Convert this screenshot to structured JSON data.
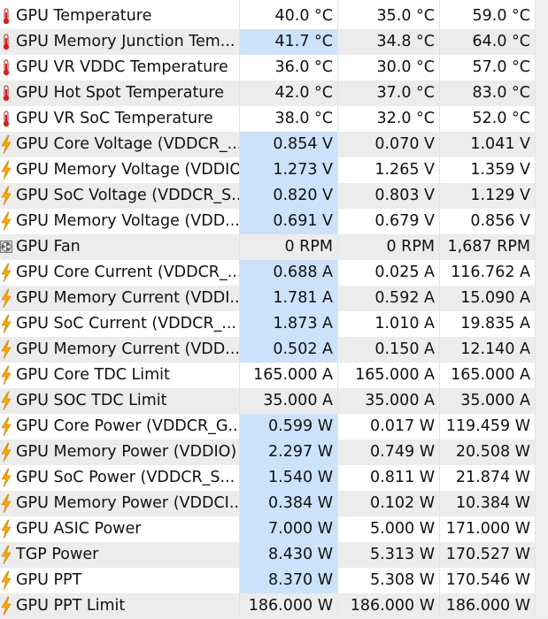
{
  "colors": {
    "alt_row": "#ececec",
    "current_highlight": "#cce2fb",
    "thermometer_red": "#d42020",
    "bolt_orange": "#f5a800",
    "fan_gray": "#666666"
  },
  "rows": [
    {
      "icon": "thermometer-icon",
      "name": "GPU Temperature",
      "current": "40.0 °C",
      "min": "35.0 °C",
      "max": "59.0 °C",
      "hl": false
    },
    {
      "icon": "thermometer-icon",
      "name": "GPU Memory Junction Tem...",
      "current": "41.7 °C",
      "min": "34.8 °C",
      "max": "64.0 °C",
      "hl": true
    },
    {
      "icon": "thermometer-icon",
      "name": "GPU VR VDDC Temperature",
      "current": "36.0 °C",
      "min": "30.0 °C",
      "max": "57.0 °C",
      "hl": false
    },
    {
      "icon": "thermometer-icon",
      "name": "GPU Hot Spot Temperature",
      "current": "42.0 °C",
      "min": "37.0 °C",
      "max": "83.0 °C",
      "hl": false
    },
    {
      "icon": "thermometer-icon",
      "name": "GPU VR SoC Temperature",
      "current": "38.0 °C",
      "min": "32.0 °C",
      "max": "52.0 °C",
      "hl": false
    },
    {
      "icon": "lightning-bolt-icon",
      "name": "GPU Core Voltage (VDDCR_...",
      "current": "0.854 V",
      "min": "0.070 V",
      "max": "1.041 V",
      "hl": true
    },
    {
      "icon": "lightning-bolt-icon",
      "name": "GPU Memory Voltage (VDDIO)",
      "current": "1.273 V",
      "min": "1.265 V",
      "max": "1.359 V",
      "hl": true
    },
    {
      "icon": "lightning-bolt-icon",
      "name": "GPU SoC Voltage (VDDCR_S...",
      "current": "0.820 V",
      "min": "0.803 V",
      "max": "1.129 V",
      "hl": true
    },
    {
      "icon": "lightning-bolt-icon",
      "name": "GPU Memory Voltage (VDD...",
      "current": "0.691 V",
      "min": "0.679 V",
      "max": "0.856 V",
      "hl": true
    },
    {
      "icon": "fan-icon",
      "name": "GPU Fan",
      "current": "0 RPM",
      "min": "0 RPM",
      "max": "1,687 RPM",
      "hl": false
    },
    {
      "icon": "lightning-bolt-icon",
      "name": "GPU Core Current (VDDCR_...",
      "current": "0.688 A",
      "min": "0.025 A",
      "max": "116.762 A",
      "hl": true
    },
    {
      "icon": "lightning-bolt-icon",
      "name": "GPU Memory Current (VDDI...",
      "current": "1.781 A",
      "min": "0.592 A",
      "max": "15.090 A",
      "hl": true
    },
    {
      "icon": "lightning-bolt-icon",
      "name": "GPU SoC Current (VDDCR_...",
      "current": "1.873 A",
      "min": "1.010 A",
      "max": "19.835 A",
      "hl": true
    },
    {
      "icon": "lightning-bolt-icon",
      "name": "GPU Memory Current (VDD...",
      "current": "0.502 A",
      "min": "0.150 A",
      "max": "12.140 A",
      "hl": true
    },
    {
      "icon": "lightning-bolt-icon",
      "name": "GPU Core TDC Limit",
      "current": "165.000 A",
      "min": "165.000 A",
      "max": "165.000 A",
      "hl": false
    },
    {
      "icon": "lightning-bolt-icon",
      "name": "GPU SOC TDC Limit",
      "current": "35.000 A",
      "min": "35.000 A",
      "max": "35.000 A",
      "hl": false
    },
    {
      "icon": "lightning-bolt-icon",
      "name": "GPU Core Power (VDDCR_G...",
      "current": "0.599 W",
      "min": "0.017 W",
      "max": "119.459 W",
      "hl": true
    },
    {
      "icon": "lightning-bolt-icon",
      "name": "GPU Memory Power (VDDIO)",
      "current": "2.297 W",
      "min": "0.749 W",
      "max": "20.508 W",
      "hl": true
    },
    {
      "icon": "lightning-bolt-icon",
      "name": "GPU SoC Power (VDDCR_S...",
      "current": "1.540 W",
      "min": "0.811 W",
      "max": "21.874 W",
      "hl": true
    },
    {
      "icon": "lightning-bolt-icon",
      "name": "GPU Memory Power (VDDCI...",
      "current": "0.384 W",
      "min": "0.102 W",
      "max": "10.384 W",
      "hl": true
    },
    {
      "icon": "lightning-bolt-icon",
      "name": "GPU ASIC Power",
      "current": "7.000 W",
      "min": "5.000 W",
      "max": "171.000 W",
      "hl": true
    },
    {
      "icon": "lightning-bolt-icon",
      "name": "TGP Power",
      "current": "8.430 W",
      "min": "5.313 W",
      "max": "170.527 W",
      "hl": true
    },
    {
      "icon": "lightning-bolt-icon",
      "name": "GPU PPT",
      "current": "8.370 W",
      "min": "5.308 W",
      "max": "170.546 W",
      "hl": true
    },
    {
      "icon": "lightning-bolt-icon",
      "name": "GPU PPT Limit",
      "current": "186.000 W",
      "min": "186.000 W",
      "max": "186.000 W",
      "hl": false
    }
  ]
}
